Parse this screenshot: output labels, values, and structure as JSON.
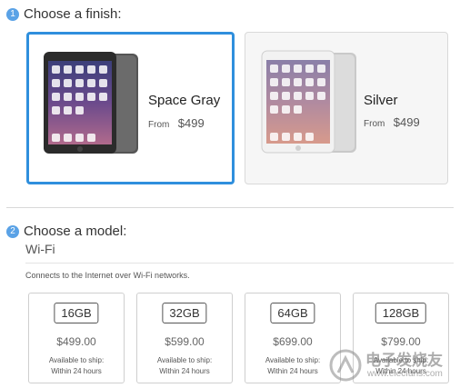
{
  "step1": {
    "number": "1",
    "title": "Choose a finish:"
  },
  "finishes": [
    {
      "name": "Space Gray",
      "from": "From",
      "price": "$499",
      "selected": true
    },
    {
      "name": "Silver",
      "from": "From",
      "price": "$499",
      "selected": false
    }
  ],
  "step2": {
    "number": "2",
    "title": "Choose a model:"
  },
  "model_section": {
    "connectivity": "Wi-Fi",
    "description": "Connects to the Internet over Wi-Fi networks."
  },
  "models": [
    {
      "capacity": "16GB",
      "price": "$499.00",
      "ship_line1": "Available to ship:",
      "ship_line2": "Within 24 hours"
    },
    {
      "capacity": "32GB",
      "price": "$599.00",
      "ship_line1": "Available to ship:",
      "ship_line2": "Within 24 hours"
    },
    {
      "capacity": "64GB",
      "price": "$699.00",
      "ship_line1": "Available to ship:",
      "ship_line2": "Within 24 hours"
    },
    {
      "capacity": "128GB",
      "price": "$799.00",
      "ship_line1": "Available to ship:",
      "ship_line2": "Within 24 hours"
    }
  ],
  "watermark": {
    "text": "电子发烧友",
    "url_text": "www.elecfans.com"
  },
  "colors": {
    "accent": "#2f8fdd",
    "step_badge": "#5aa2e6",
    "space_gray": "#2b2b2b",
    "silver": "#e8e8e8"
  },
  "icons": [
    "step-number-badge",
    "ipad-device-image",
    "watermark-logo"
  ]
}
